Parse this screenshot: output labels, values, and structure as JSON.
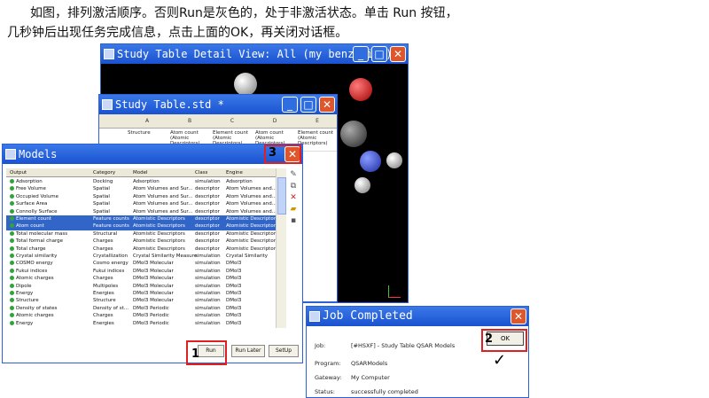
{
  "instructions": {
    "line1": "如图，排列激活顺序。否则Run是灰色的，处于非激活状态。单击 Run 按钮，",
    "line2": "几秒钟后出现任务完成信息，点击上面的OK，再关闭对话框。"
  },
  "detail_view": {
    "title": "Study Table Detail View: All (my benzamide)"
  },
  "study_table": {
    "title": "Study Table.std *",
    "columns": [
      "A",
      "B",
      "C",
      "D",
      "E"
    ],
    "row": [
      "Structure",
      "Atom count (Atomic Descriptors)",
      "Element count (Atomic Descriptors)",
      "Atom count (Atomic Descriptors)",
      "Element count (Atomic Descriptors)"
    ]
  },
  "models": {
    "title": "Models",
    "headers": [
      "Output",
      "Category",
      "Model",
      "Class",
      "Engine"
    ],
    "rows": [
      [
        "Adsorption",
        "Docking",
        "Adsorption",
        "simulation",
        "Adsorption",
        false
      ],
      [
        "Free Volume",
        "Spatial",
        "Atom Volumes and Sur...",
        "descriptor",
        "Atom Volumes and...",
        false
      ],
      [
        "Occupied Volume",
        "Spatial",
        "Atom Volumes and Sur...",
        "descriptor",
        "Atom Volumes and...",
        false
      ],
      [
        "Surface Area",
        "Spatial",
        "Atom Volumes and Sur...",
        "descriptor",
        "Atom Volumes and...",
        false
      ],
      [
        "Connolly Surface",
        "Spatial",
        "Atom Volumes and Sur...",
        "descriptor",
        "Atom Volumes and...",
        false
      ],
      [
        "Element count",
        "Feature counts",
        "Atomistic Descriptors",
        "descriptor",
        "Atomistic Descriptors",
        true
      ],
      [
        "Atom count",
        "Feature counts",
        "Atomistic Descriptors",
        "descriptor",
        "Atomistic Descriptors",
        true
      ],
      [
        "Total molecular mass",
        "Structural",
        "Atomistic Descriptors",
        "descriptor",
        "Atomistic Descriptors",
        false
      ],
      [
        "Total formal charge",
        "Charges",
        "Atomistic Descriptors",
        "descriptor",
        "Atomistic Descriptors",
        false
      ],
      [
        "Total charge",
        "Charges",
        "Atomistic Descriptors",
        "descriptor",
        "Atomistic Descriptors",
        false
      ],
      [
        "Crystal similarity",
        "Crystallization",
        "Crystal Similarity Measure",
        "simulation",
        "Crystal Similarity",
        false
      ],
      [
        "COSMO energy",
        "Cosmo energy",
        "DMol3 Molecular",
        "simulation",
        "DMol3",
        false
      ],
      [
        "Fukui indices",
        "Fukui indices",
        "DMol3 Molecular",
        "simulation",
        "DMol3",
        false
      ],
      [
        "Atomic charges",
        "Charges",
        "DMol3 Molecular",
        "simulation",
        "DMol3",
        false
      ],
      [
        "Dipole",
        "Multipoles",
        "DMol3 Molecular",
        "simulation",
        "DMol3",
        false
      ],
      [
        "Energy",
        "Energies",
        "DMol3 Molecular",
        "simulation",
        "DMol3",
        false
      ],
      [
        "Structure",
        "Structure",
        "DMol3 Molecular",
        "simulation",
        "DMol3",
        false
      ],
      [
        "Density of states",
        "Density of st...",
        "DMol3 Periodic",
        "simulation",
        "DMol3",
        false
      ],
      [
        "Atomic charges",
        "Charges",
        "DMol3 Periodic",
        "simulation",
        "DMol3",
        false
      ],
      [
        "Energy",
        "Energies",
        "DMol3 Periodic",
        "simulation",
        "DMol3",
        false
      ],
      [
        "Structure",
        "Structure",
        "DMol3 Periodic",
        "simulation",
        "DMol3",
        false
      ]
    ],
    "buttons": {
      "run": "Run",
      "run_later": "Run Later",
      "setup": "SetUp"
    }
  },
  "job": {
    "title": "Job Completed",
    "labels": {
      "job": "Job:",
      "program": "Program:",
      "gateway": "Gateway:",
      "status": "Status:"
    },
    "values": {
      "job": "[#HSXF] - Study Table QSAR Models",
      "program": "QSARModels",
      "gateway": "My Computer",
      "status": "successfully completed"
    },
    "ok": "OK"
  },
  "annotations": {
    "one": "1",
    "two": "2",
    "three": "3"
  }
}
